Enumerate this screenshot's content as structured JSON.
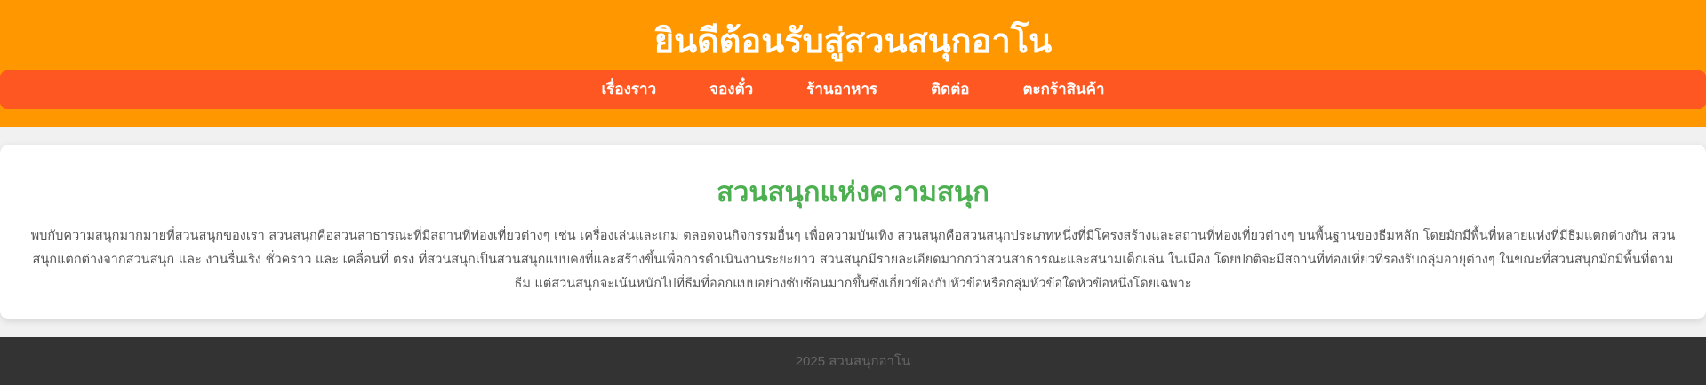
{
  "header": {
    "title": "ยินดีต้อนรับสู่สวนสนุกอาโน"
  },
  "nav": {
    "items": [
      {
        "label": "เรื่องราว"
      },
      {
        "label": "จองตั๋ว"
      },
      {
        "label": "ร้านอาหาร"
      },
      {
        "label": "ติดต่อ"
      },
      {
        "label": "ตะกร้าสินค้า"
      }
    ]
  },
  "main": {
    "heading": "สวนสนุกแห่งความสนุก",
    "body": "พบกับความสนุกมากมายที่สวนสนุกของเรา สวนสนุกคือสวนสาธารณะที่มีสถานที่ท่องเที่ยวต่างๆ เช่น เครื่องเล่นและเกม ตลอดจนกิจกรรมอื่นๆ เพื่อความบันเทิง สวนสนุกคือสวนสนุกประเภทหนึ่งที่มีโครงสร้างและสถานที่ท่องเที่ยวต่างๆ บนพื้นฐานของธีมหลัก โดยมักมีพื้นที่หลายแห่งที่มีธีมแตกต่างกัน สวนสนุกแตกต่างจากสวนสนุก และ งานรื่นเริง ชั่วคราว และ เคลื่อนที่ ตรง ที่สวนสนุกเป็นสวนสนุกแบบคงที่และสร้างขึ้นเพื่อการดำเนินงานระยะยาว สวนสนุกมีรายละเอียดมากกว่าสวนสาธารณะและสนามเด็กเล่น ในเมือง โดยปกติจะมีสถานที่ท่องเที่ยวที่รองรับกลุ่มอายุต่างๆ ในขณะที่สวนสนุกมักมีพื้นที่ตามธีม แต่สวนสนุกจะเน้นหนักไปที่ธีมที่ออกแบบอย่างซับซ้อนมากขึ้นซึ่งเกี่ยวข้องกับหัวข้อหรือกลุ่มหัวข้อใดหัวข้อหนึ่งโดยเฉพาะ"
  },
  "footer": {
    "text": "2025 สวนสนุกอาโน"
  },
  "colors": {
    "header_bg": "#ff9800",
    "nav_bg": "#ff5722",
    "heading": "#4caf50",
    "footer_bg": "#333333"
  }
}
